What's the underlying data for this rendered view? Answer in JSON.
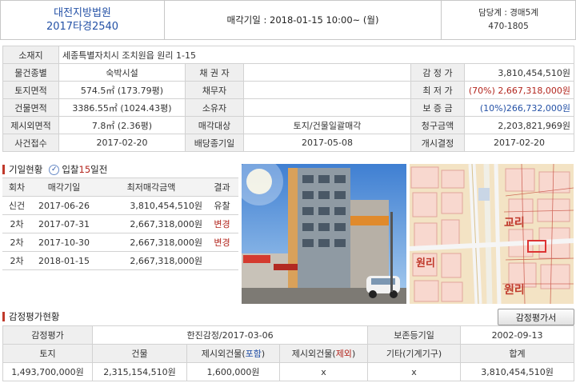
{
  "header": {
    "court_name": "대전지방법원",
    "case_no": "2017타경2540",
    "auction_date": "매각기일 : 2018-01-15  10:00~ (월)",
    "dept_label": "담당계 : 경매5계",
    "dept_phone": "470-1805"
  },
  "info": {
    "location_label": "소재지",
    "location_value": "세종특별자치시 조치원읍 원리 1-15",
    "type_label": "물건종별",
    "type_value": "숙박시설",
    "creditor_label": "채 권 자",
    "creditor_value": "",
    "appraisal_label": "감 정 가",
    "appraisal_value": "3,810,454,510원",
    "land_label": "토지면적",
    "land_value": "574.5㎡ (173.79평)",
    "debtor_label": "채무자",
    "debtor_value": "",
    "min_price_label": "최 저 가",
    "min_price_value": "(70%) 2,667,318,000원",
    "bldg_label": "건물면적",
    "bldg_value": "3386.55㎡ (1024.43평)",
    "owner_label": "소유자",
    "owner_value": "",
    "deposit_label": "보 증 금",
    "deposit_value": "(10%)266,732,000원",
    "excl_label": "제시외면적",
    "excl_value": "7.8㎡ (2.36평)",
    "sale_target_label": "매각대상",
    "sale_target_value": "토지/건물일괄매각",
    "claim_label": "청구금액",
    "claim_value": "2,203,821,969원",
    "case_recv_label": "사건접수",
    "case_recv_value": "2017-02-20",
    "dividend_label": "배당종기일",
    "dividend_value": "2017-05-08",
    "start_label": "개시결정",
    "start_value": "2017-02-20"
  },
  "history": {
    "title": "기일현황",
    "badge": "입찰",
    "badge_days": "15",
    "badge_suffix": "일전",
    "columns": [
      "회차",
      "매각기일",
      "최저매각금액",
      "결과"
    ],
    "rows": [
      {
        "round": "신건",
        "date": "2017-06-26",
        "price": "3,810,454,510원",
        "result": "유찰",
        "result_color": "#333333"
      },
      {
        "round": "2차",
        "date": "2017-07-31",
        "price": "2,667,318,000원",
        "result": "변경",
        "result_color": "#b3261e"
      },
      {
        "round": "2차",
        "date": "2017-10-30",
        "price": "2,667,318,000원",
        "result": "변경",
        "result_color": "#b3261e"
      },
      {
        "round": "2차",
        "date": "2018-01-15",
        "price": "2,667,318,000원",
        "result": "",
        "result_color": "#333333"
      }
    ]
  },
  "photos": {
    "map_label_1": "원리",
    "map_label_2": "교리",
    "map_label_3": "원리"
  },
  "appraisal": {
    "title": "감정평가현황",
    "button": "감정평가서",
    "agency_label": "감정평가",
    "agency_value": "한진감정/2017-03-06",
    "preserve_label": "보존등기일",
    "preserve_value": "2002-09-13",
    "col_land": "토지",
    "col_bldg": "건물",
    "col_excl_incl_prefix": "제시외건물(",
    "col_excl_incl_mark": "포함",
    "col_excl_excl_prefix": "제시외건물(",
    "col_excl_excl_mark": "제외",
    "col_paren_close": ")",
    "col_other": "기타(기계기구)",
    "col_total": "합계",
    "val_land": "1,493,700,000원",
    "val_bldg": "2,315,154,510원",
    "val_excl_incl": "1,600,000원",
    "val_excl_excl": "x",
    "val_other": "x",
    "val_total": "3,810,454,510원"
  }
}
